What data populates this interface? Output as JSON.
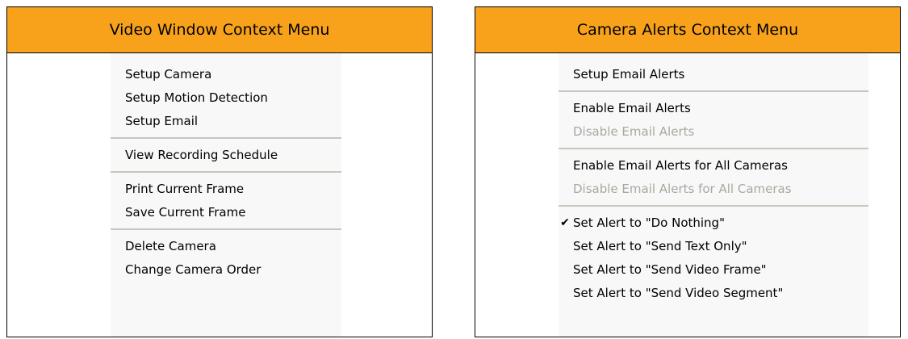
{
  "left_panel": {
    "title": "Video Window Context Menu",
    "groups": [
      [
        "Setup Camera",
        "Setup Motion Detection",
        "Setup Email"
      ],
      [
        "View Recording Schedule"
      ],
      [
        "Print Current Frame",
        "Save Current Frame"
      ],
      [
        "Delete Camera",
        "Change Camera Order"
      ]
    ]
  },
  "right_panel": {
    "title": "Camera Alerts Context Menu",
    "items": [
      {
        "label": "Setup Email Alerts",
        "enabled": true
      },
      {
        "label": "Enable Email Alerts",
        "enabled": true
      },
      {
        "label": "Disable Email Alerts",
        "enabled": false
      },
      {
        "label": "Enable Email Alerts for All Cameras",
        "enabled": true
      },
      {
        "label": "Disable Email Alerts for All Cameras",
        "enabled": false
      },
      {
        "label": "Set Alert to \"Do Nothing\"",
        "enabled": true,
        "checked": true
      },
      {
        "label": "Set Alert to \"Send Text Only\"",
        "enabled": true
      },
      {
        "label": "Set Alert to \"Send Video Frame\"",
        "enabled": true
      },
      {
        "label": "Set Alert to \"Send Video Segment\"",
        "enabled": true
      }
    ],
    "check_glyph": "✔"
  },
  "colors": {
    "header_orange": "#f8a21c",
    "disabled_text": "#aaa7a0",
    "separator": "#c8c5bc",
    "menu_background": "#f8f8f8"
  }
}
